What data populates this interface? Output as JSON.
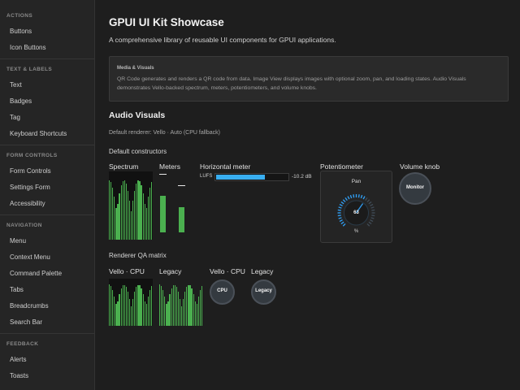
{
  "sidebar": {
    "sections": [
      {
        "title": "ACTIONS",
        "items": [
          "Buttons",
          "Icon Buttons"
        ]
      },
      {
        "title": "TEXT & LABELS",
        "items": [
          "Text",
          "Badges",
          "Tag",
          "Keyboard Shortcuts"
        ]
      },
      {
        "title": "FORM CONTROLS",
        "items": [
          "Form Controls",
          "Settings Form",
          "Accessibility"
        ]
      },
      {
        "title": "NAVIGATION",
        "items": [
          "Menu",
          "Context Menu",
          "Command Palette",
          "Tabs",
          "Breadcrumbs",
          "Search Bar"
        ]
      },
      {
        "title": "FEEDBACK",
        "items": [
          "Alerts",
          "Toasts"
        ]
      }
    ]
  },
  "main": {
    "title": "GPUI UI Kit Showcase",
    "description": "A comprehensive library of reusable UI components for GPUI applications.",
    "info": {
      "title": "Media & Visuals",
      "text": "QR Code generates and renders a QR code from data. Image View displays images with optional zoom, pan, and loading states. Audio Visuals demonstrates Vello-backed spectrum, meters, potentiometers, and volume knobs."
    },
    "section_title": "Audio Visuals",
    "renderer_note": "Default renderer: Vello · Auto (CPU fallback)",
    "constructors_title": "Default constructors",
    "labels": {
      "spectrum": "Spectrum",
      "meters": "Meters",
      "hmeter": "Horizontal meter",
      "pot": "Potentiometer",
      "knob": "Volume knob"
    },
    "hmeter": {
      "unit": "LUFS",
      "value_text": "-10.2 dB",
      "level": 0.68
    },
    "meters": {
      "levels": [
        0.62,
        0.5
      ]
    },
    "pot": {
      "name": "Pan",
      "value": "63",
      "unit": "%",
      "level": 0.63,
      "accent": "#2f9cf0"
    },
    "knob_label": "Monitor",
    "qa_title": "Renderer QA matrix",
    "qa_labels": {
      "a": "Vello · CPU",
      "b": "Legacy",
      "c": "Vello · CPU",
      "d": "Legacy"
    },
    "qa_knobs": {
      "cpu": "CPU",
      "legacy": "Legacy"
    },
    "colors": {
      "bar": "#4bb04f",
      "meter_fill": "#2f9cf0",
      "accent": "#2f9cf0"
    }
  }
}
